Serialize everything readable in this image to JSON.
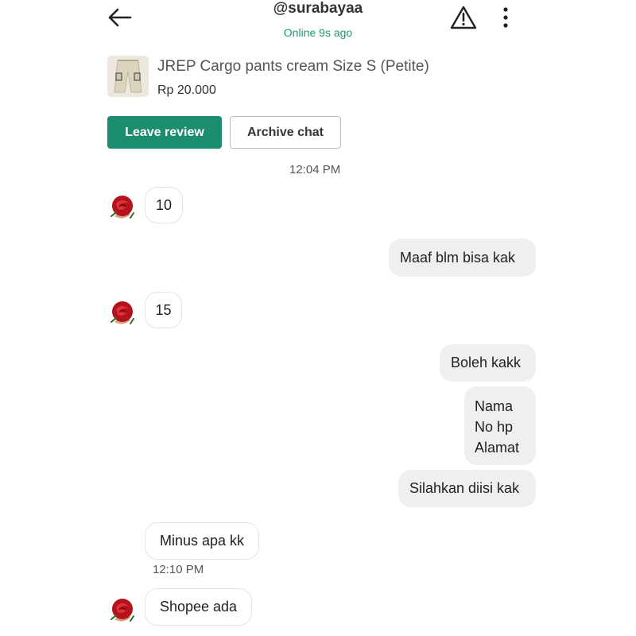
{
  "header": {
    "title": "@surabayaa",
    "status": "Online 9s ago"
  },
  "icons": {
    "back": "arrow-left-icon",
    "report": "warning-triangle-icon",
    "more": "more-vertical-icon",
    "avatar": "rose-avatar"
  },
  "product": {
    "name": "JREP Cargo pants cream Size S (Petite)",
    "price": "Rp 20.000"
  },
  "actions": {
    "leave_review": "Leave review",
    "archive_chat": "Archive chat"
  },
  "colors": {
    "accent": "#1a8e6e",
    "online_status": "#1a9a73",
    "outgoing_bubble": "#efefef",
    "incoming_bubble": "#ffffff"
  },
  "chat": {
    "time_1": "12:04 PM",
    "time_2": "12:10 PM",
    "messages": [
      {
        "from": "seller",
        "text": "10"
      },
      {
        "from": "me",
        "text": "Maaf blm bisa kak"
      },
      {
        "from": "seller",
        "text": "15"
      },
      {
        "from": "me",
        "text": "Boleh kakk"
      },
      {
        "from": "me",
        "lines": [
          "Nama",
          "No hp",
          "Alamat"
        ]
      },
      {
        "from": "me",
        "text": "Silahkan diisi kak"
      },
      {
        "from": "seller",
        "text": "Minus apa kk"
      },
      {
        "from": "seller",
        "text": "Shopee ada"
      }
    ]
  }
}
